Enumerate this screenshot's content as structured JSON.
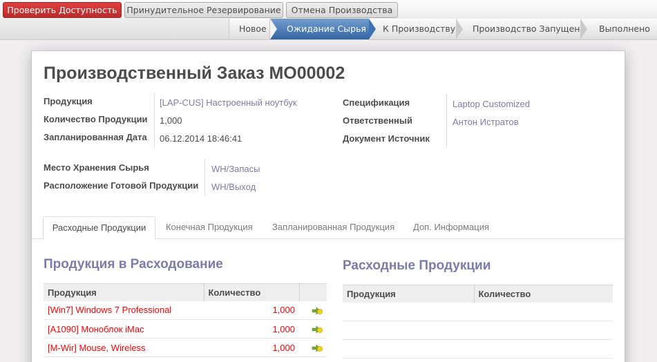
{
  "toolbar": {
    "check_availability": "Проверить Доступность",
    "force_reservation": "Принудительное Резервирование",
    "cancel_production": "Отмена Производства"
  },
  "statusbar": {
    "stages": [
      "Новое",
      "Ожидание Сырья",
      "К Производству",
      "Производство Запущено",
      "Выполнено"
    ],
    "active_stage": "Ожидание Сырья"
  },
  "form": {
    "title": "Производственный Заказ MO00002",
    "fields": {
      "product_label": "Продукция",
      "product_value": "[LAP-CUS] Настроенный ноутбук",
      "qty_label": "Количество Продукции",
      "qty_value": "1,000",
      "date_label": "Запланированная Дата",
      "date_value": "06.12.2014 18:46:41",
      "bom_label": "Спецификация",
      "bom_value": "Laptop Customized",
      "responsible_label": "Ответственный",
      "responsible_value": "Антон Истратов",
      "source_label": "Документ Источник",
      "source_value": "",
      "raw_location_label": "Место Хранения Сырья",
      "raw_location_value": "WH/Запасы",
      "finished_location_label": "Расположение Готовой Продукции",
      "finished_location_value": "WH/Выход"
    }
  },
  "tabs": [
    "Расходные Продукции",
    "Конечная Продукция",
    "Запланированная Продукция",
    "Доп. Информация"
  ],
  "to_consume": {
    "title": "Продукция в Расходование",
    "columns": [
      "Продукция",
      "Количество"
    ],
    "rows": [
      {
        "product": "[Win7] Windows 7 Professional",
        "qty": "1,000"
      },
      {
        "product": "[A1090] Моноблок iMac",
        "qty": "1,000"
      },
      {
        "product": "[M-Wir] Mouse, Wireless",
        "qty": "1,000"
      }
    ]
  },
  "consumed": {
    "title": "Расходные Продукции",
    "columns": [
      "Продукция",
      "Количество"
    ]
  },
  "colors": {
    "accent": "#7c7bad",
    "primary_button": "#c73232",
    "active_stage": "#3f72b0",
    "unavailable_product": "#ff0000"
  }
}
